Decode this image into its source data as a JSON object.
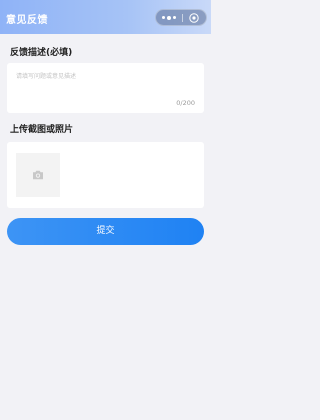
{
  "header": {
    "title": "意见反馈",
    "capsule": {
      "more_icon": "more-dots-icon",
      "close_icon": "close-circle-icon"
    }
  },
  "feedback": {
    "label": "反馈描述(必填)",
    "placeholder": "请填写问题或意见描述",
    "value": "",
    "counter": "0/200"
  },
  "upload": {
    "label": "上传截图或照片",
    "icon": "camera-icon"
  },
  "submit": {
    "label": "提交"
  },
  "colors": {
    "primary": "#2a8af4",
    "header_gradient_start": "#8fb3f7",
    "page_background": "#f2f2f6"
  }
}
